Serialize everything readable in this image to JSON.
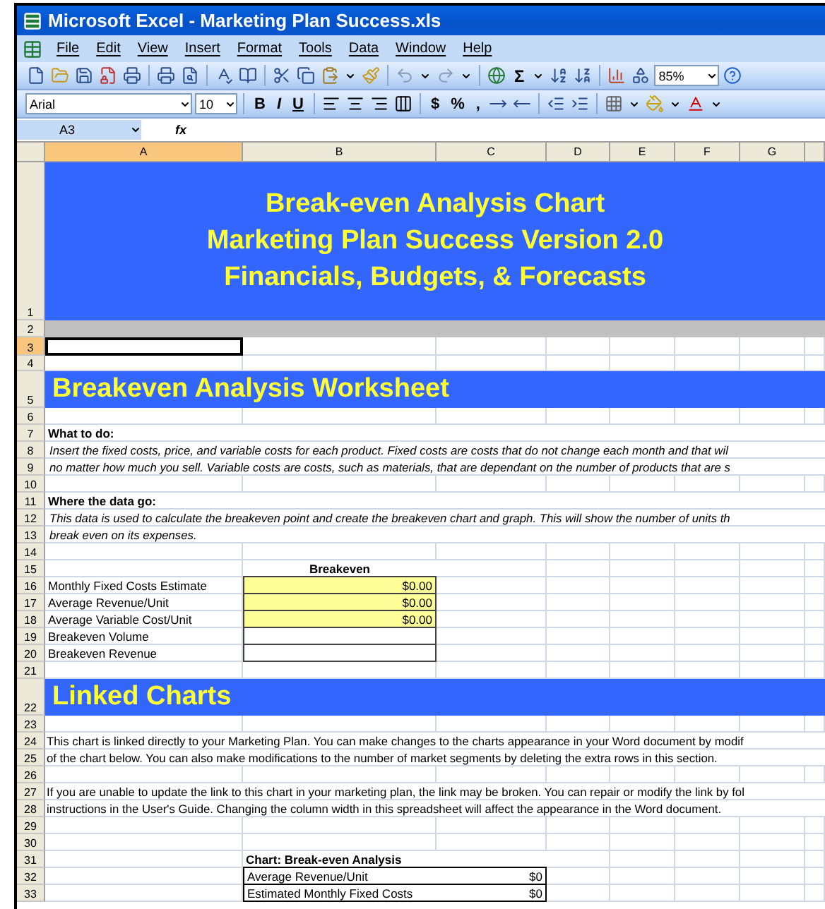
{
  "window": {
    "title": "Microsoft Excel - Marketing Plan Success.xls"
  },
  "menu": [
    "File",
    "Edit",
    "View",
    "Insert",
    "Format",
    "Tools",
    "Data",
    "Window",
    "Help"
  ],
  "standard_toolbar": {
    "sum": "Σ",
    "zoom": "85%"
  },
  "formatting_toolbar": {
    "font": "Arial",
    "size": "10",
    "styles": [
      "B",
      "I",
      "U"
    ],
    "number_formats": [
      "$",
      "%",
      ","
    ]
  },
  "formula_bar": {
    "name_box": "A3",
    "function_label": "fx"
  },
  "columns": [
    {
      "label": "A",
      "selected": true
    },
    {
      "label": "B",
      "selected": false
    },
    {
      "label": "C",
      "selected": false
    },
    {
      "label": "D",
      "selected": false
    },
    {
      "label": "E",
      "selected": false
    },
    {
      "label": "F",
      "selected": false
    },
    {
      "label": "G",
      "selected": false
    }
  ],
  "rows": [
    {
      "number": "1",
      "kind": "banner",
      "selected": false,
      "lines": [
        "Break-even Analysis Chart",
        "Marketing Plan Success Version 2.0",
        "Financials, Budgets, & Forecasts"
      ]
    },
    {
      "number": "2",
      "kind": "separator",
      "selected": false
    },
    {
      "number": "3",
      "kind": "blank",
      "selected": true
    },
    {
      "number": "4",
      "kind": "blank",
      "selected": false
    },
    {
      "number": "5",
      "kind": "section",
      "selected": false,
      "text": "Breakeven Analysis Worksheet"
    },
    {
      "number": "6",
      "kind": "blank",
      "selected": false
    },
    {
      "number": "7",
      "kind": "heading",
      "selected": false,
      "text": "What to do:"
    },
    {
      "number": "8",
      "kind": "note",
      "selected": false,
      "text": "Insert the fixed costs, price, and variable costs for each product.  Fixed costs are costs that do not change each month and that wil"
    },
    {
      "number": "9",
      "kind": "note",
      "selected": false,
      "text": "no matter how much you sell.  Variable costs are costs, such as materials, that are dependant on the number of products that are s"
    },
    {
      "number": "10",
      "kind": "blank",
      "selected": false
    },
    {
      "number": "11",
      "kind": "heading",
      "selected": false,
      "text": "Where the data go:"
    },
    {
      "number": "12",
      "kind": "note",
      "selected": false,
      "text": "This data is used to calculate the breakeven point and create the breakeven chart and graph.  This will show the number of units th"
    },
    {
      "number": "13",
      "kind": "note",
      "selected": false,
      "text": "break even on its expenses."
    },
    {
      "number": "14",
      "kind": "blank",
      "selected": false
    },
    {
      "number": "15",
      "kind": "column_heading",
      "selected": false,
      "text": "Breakeven"
    },
    {
      "number": "16",
      "kind": "input",
      "selected": false,
      "label": "Monthly Fixed Costs Estimate",
      "value": "$0.00"
    },
    {
      "number": "17",
      "kind": "input",
      "selected": false,
      "label": "Average Revenue/Unit",
      "value": "$0.00"
    },
    {
      "number": "18",
      "kind": "input",
      "selected": false,
      "label": "Average Variable Cost/Unit",
      "value": "$0.00"
    },
    {
      "number": "19",
      "kind": "output",
      "selected": false,
      "label": "Breakeven Volume"
    },
    {
      "number": "20",
      "kind": "output",
      "selected": false,
      "label": "Breakeven Revenue"
    },
    {
      "number": "21",
      "kind": "blank",
      "selected": false
    },
    {
      "number": "22",
      "kind": "section",
      "selected": false,
      "text": "Linked Charts"
    },
    {
      "number": "23",
      "kind": "blank",
      "selected": false
    },
    {
      "number": "24",
      "kind": "text",
      "selected": false,
      "text": "This chart is linked directly to your Marketing Plan.  You can make changes to the charts appearance in your Word document by modif"
    },
    {
      "number": "25",
      "kind": "text",
      "selected": false,
      "text": "of the chart below.  You can also make modifications to the number of market segments by deleting the extra rows in this section."
    },
    {
      "number": "26",
      "kind": "blank",
      "selected": false
    },
    {
      "number": "27",
      "kind": "text",
      "selected": false,
      "text": " If you are unable to update the link to this chart in your marketing plan, the link may be broken.  You can repair or modify the link by fol"
    },
    {
      "number": "28",
      "kind": "text",
      "selected": false,
      "text": "instructions in the User's Guide.  Changing the column width in this spreadsheet will affect the appearance in the Word document."
    },
    {
      "number": "29",
      "kind": "blank",
      "selected": false
    },
    {
      "number": "30",
      "kind": "blank",
      "selected": false
    },
    {
      "number": "31",
      "kind": "table_title",
      "selected": false,
      "text": "Chart: Break-even Analysis"
    },
    {
      "number": "32",
      "kind": "table_row",
      "selected": false,
      "label": "Average Revenue/Unit",
      "value": "$0"
    },
    {
      "number": "33",
      "kind": "table_row",
      "selected": false,
      "label": "Estimated Monthly Fixed Costs",
      "value": "$0"
    }
  ]
}
